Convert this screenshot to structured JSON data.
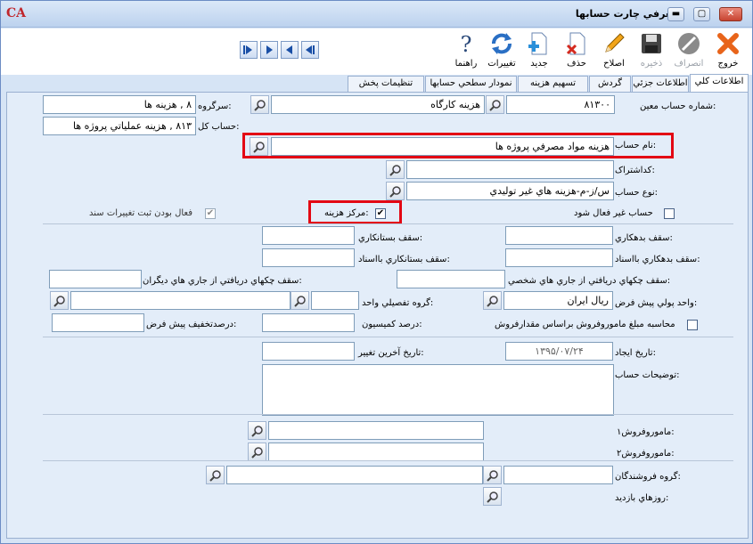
{
  "window": {
    "title": "معرفي چارت حسابها",
    "logo": "CA"
  },
  "toolbar": {
    "exit": "خروج",
    "cancel": "انصراف",
    "save": "ذخيره",
    "edit": "اصلاح",
    "delete": "حذف",
    "new": "جديد",
    "refresh": "تغييرات",
    "help": "راهنما"
  },
  "tabs": [
    "اطلاعات کلي",
    "اطلاعات جزئي",
    "گردش",
    "تسهيم هزينه",
    "نمودار سطحي حسابها",
    "تنظيمات پخش"
  ],
  "form": {
    "account_code_label": "شماره حساب معين:",
    "account_code_value": "۸۱۳۰۰",
    "account_code_name": "هزينه کارگاه",
    "group_label": "سرگروه:",
    "group_value": "۸ , هزينه ها",
    "general_label": "حساب کل:",
    "general_value": "۸۱۳ , هزينه عملياتي پروژه ها",
    "name_label": "نام حساب:",
    "name_value": "هزينه مواد مصرفي پروژه ها",
    "tax_code_label": "کداشتراک:",
    "type_label": "نوع حساب:",
    "type_value": "س/ز-م-هزينه هاي غير توليدي",
    "inactive_label": "حساب غير فعال شود",
    "cost_center_label": "مرکز هزينه:",
    "cost_center_check": "✔",
    "active_changes_label": "فعال بودن ثبت تغييرات سند",
    "active_changes_check": "✔",
    "debit_cap_label": "سقف بدهکاري:",
    "credit_cap_label": "سقف بستانکاري:",
    "debit_cap_doc_label": "سقف بدهکاري بااسناد:",
    "credit_cap_doc_label": "سقف بستانکاري بااسناد:",
    "cheque_personal_label": "سقف چکهاي دريافتي از جاري هاي شخصي:",
    "cheque_others_label": "سقف چکهاي دريافتي از جاري هاي ديگران:",
    "currency_label": "واحد پولي پيش فرض:",
    "currency_value": "ريال    ايران",
    "detail_group_label": "گروه تفصيلي واحد:",
    "calc_label": "محاسبه مبلغ ماموروفروش براساس مقدارفروش",
    "commission_label": "درصد کميسيون:",
    "discount_label": "درصدتخفيف پيش فرض:",
    "created_label": "تاريخ ايجاد:",
    "created_value": "۱۳۹۵/۰۷/۲۴",
    "modified_label": "تاريخ آخرين تغيير:",
    "desc_label": "توضيحات حساب:",
    "sales1_label": "ماموروفروش۱:",
    "sales2_label": "ماموروفروش۲:",
    "sellers_group_label": "گروه فروشندگان:",
    "visit_days_label": "روزهاي بازديد:"
  },
  "colors": {
    "highlight": "#e30613",
    "panel": "#e3edf9"
  }
}
